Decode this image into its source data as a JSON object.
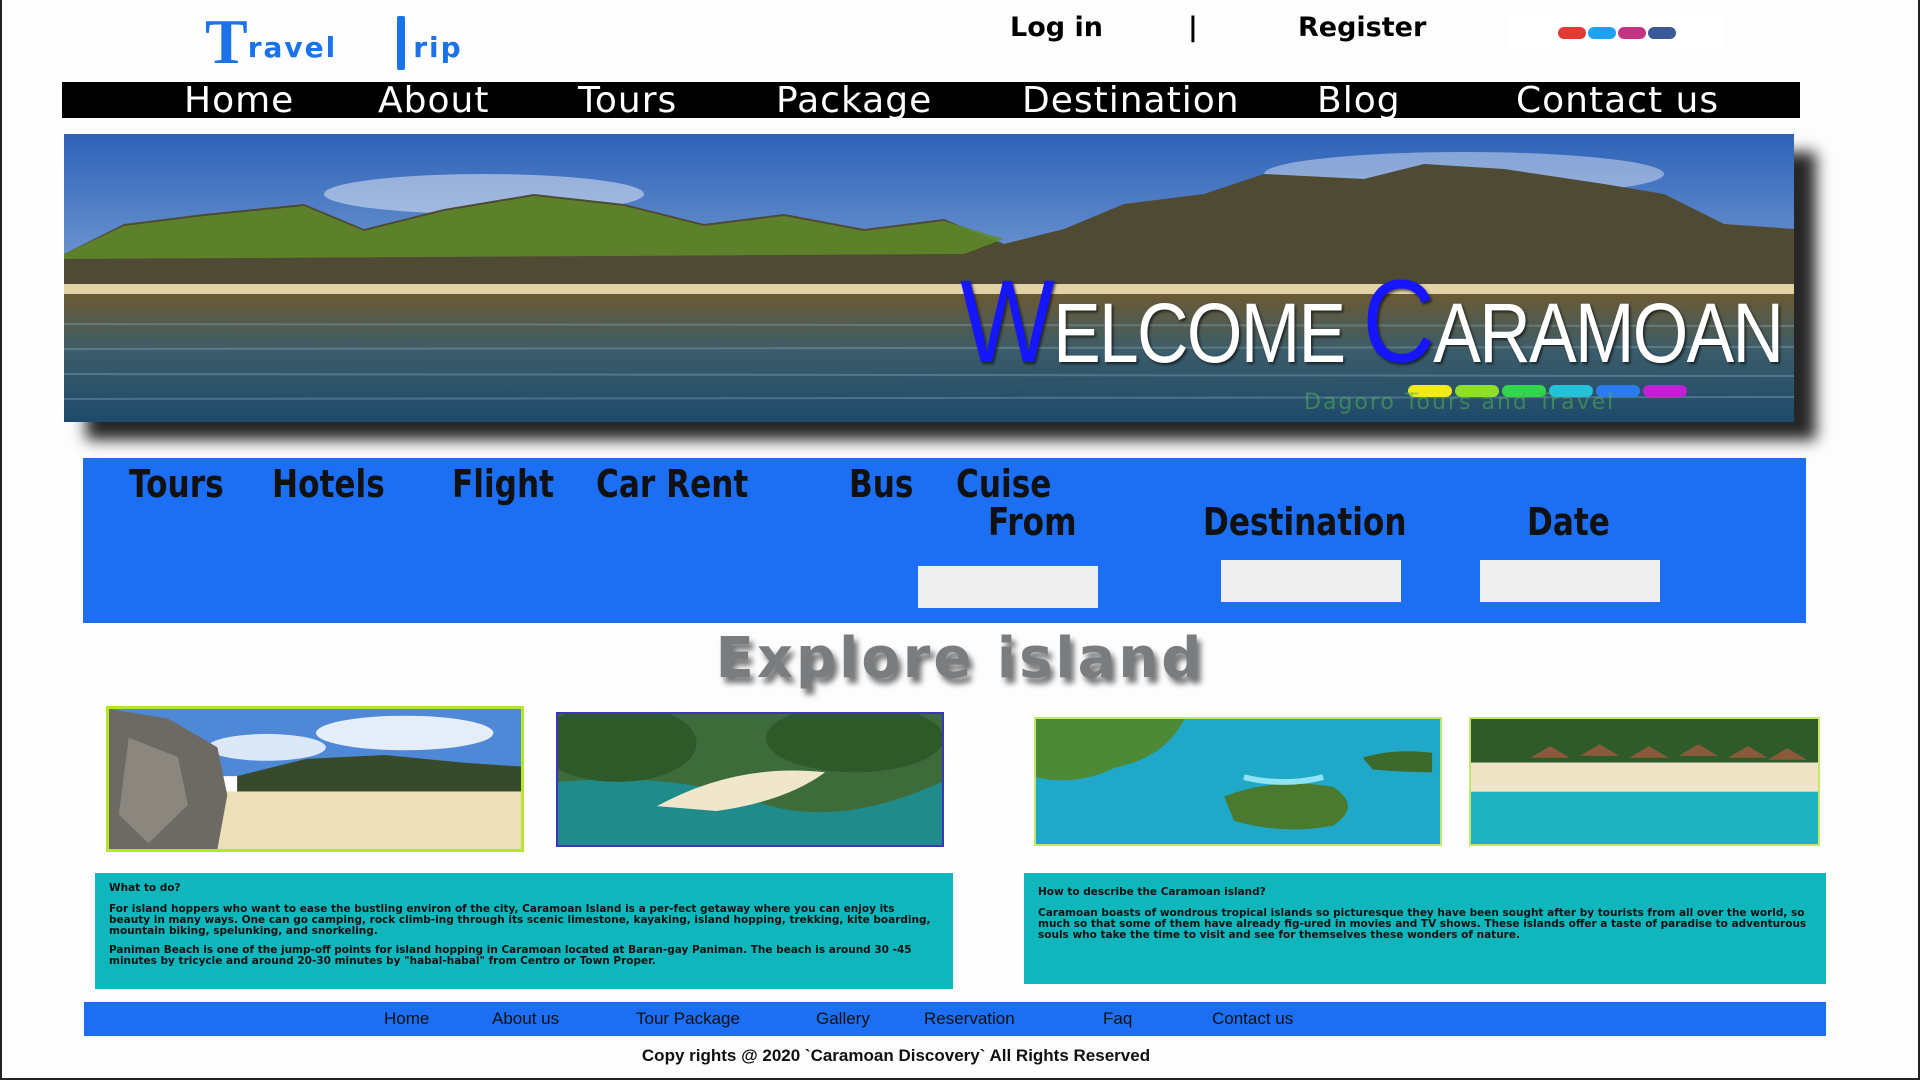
{
  "logo": {
    "t1": "T",
    "w1": "ravel",
    "w2": "rip"
  },
  "auth": {
    "login": "Log in",
    "separator": "|",
    "register": "Register"
  },
  "social_icons": [
    "youtube-icon",
    "twitter-icon",
    "instagram-icon",
    "facebook-icon"
  ],
  "nav": [
    "Home",
    "About",
    "Tours",
    "Package",
    "Destination",
    "Blog",
    "Contact us"
  ],
  "hero": {
    "welcome_w": "W",
    "welcome_rest": "ELCOME ",
    "welcome_c": "C",
    "welcome_rest2": "ARAMOAN",
    "tagline": "Dagoro Tours and Travel"
  },
  "booking": {
    "tabs": [
      "Tours",
      "Hotels",
      "Flight",
      "Car Rent",
      "Bus",
      "Cuise"
    ],
    "from_label": "From",
    "destination_label": "Destination",
    "date_label": "Date",
    "from_value": "",
    "destination_value": "",
    "date_value": ""
  },
  "explore_title": "Explore island",
  "info": {
    "left_heading": "What to do?",
    "left_p1": "For island hoppers who want to ease the bustling environ of the city, Caramoan Island is a per-fect getaway where you can enjoy its beauty in many ways. One can go camping, rock climb-ing through its scenic limestone, kayaking, island hopping, trekking, kite boarding, mountain biking, spelunking, and snorkeling.",
    "left_p2": "Paniman Beach is one of the jump-off points for island hopping in Caramoan located at Baran-gay Paniman. The beach is around 30 -45 minutes by tricycle and around 20-30 minutes by \"habal-habal\" from Centro or Town Proper.",
    "right_heading": "How to describe the Caramoan island?",
    "right_p1": "Caramoan boasts of wondrous tropical islands so picturesque they have been sought after by tourists from all over the world, so much so that some of them have already fig-ured in movies and TV shows. These islands offer a taste of paradise to adventurous souls who take the time to visit and see for themselves these wonders of nature."
  },
  "footer_nav": [
    "Home",
    "About us",
    "Tour  Package",
    "Gallery",
    "Reservation",
    "Faq",
    "Contact us"
  ],
  "copyright": "Copy rights @ 2020 `Caramoan Discovery` All Rights Reserved",
  "colors": {
    "brand_blue": "#1c6ef2",
    "teal": "#0fb7bd",
    "nav_black": "#000000"
  }
}
